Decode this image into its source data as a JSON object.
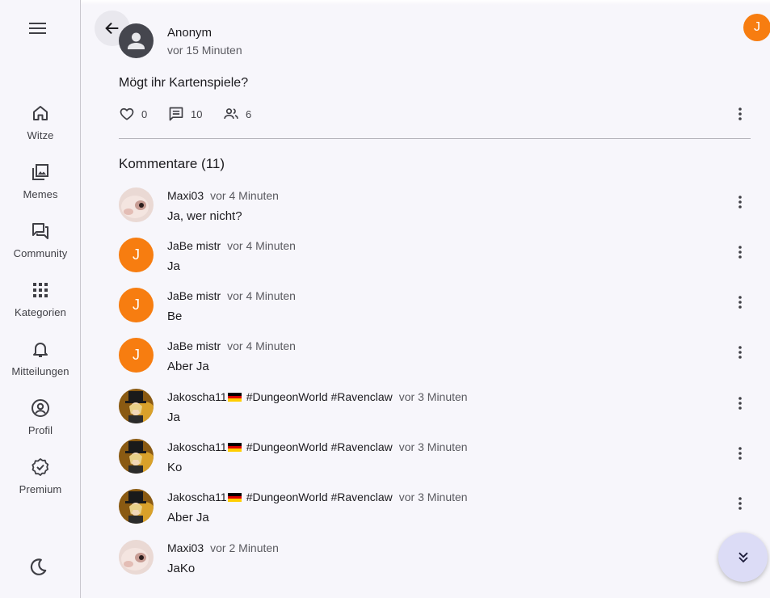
{
  "rail": {
    "menu_icon": "menu-icon",
    "items": [
      {
        "label": "Witze",
        "icon": "home-icon"
      },
      {
        "label": "Memes",
        "icon": "image-gallery-icon"
      },
      {
        "label": "Community",
        "icon": "forum-icon"
      },
      {
        "label": "Kategorien",
        "icon": "grid-icon"
      },
      {
        "label": "Mitteilungen",
        "icon": "bell-icon"
      },
      {
        "label": "Profil",
        "icon": "account-circle-icon"
      },
      {
        "label": "Premium",
        "icon": "verified-badge-icon"
      }
    ],
    "theme_icon": "moon-icon"
  },
  "header": {
    "back_icon": "arrow-back-icon",
    "user_avatar_initial": "J"
  },
  "post": {
    "author": "Anonym",
    "time": "vor 15 Minuten",
    "text": "Mögt ihr Kartenspiele?",
    "likes": "0",
    "comments": "10",
    "participants": "6"
  },
  "comments_heading": "Kommentare (11)",
  "comments": [
    {
      "author": "Maxi03",
      "time": "vor 4 Minuten",
      "text": "Ja, wer nicht?",
      "avatar": "photo-hamster"
    },
    {
      "author": "JaBe mistr",
      "time": "vor 4 Minuten",
      "text": "Ja",
      "avatar": "J"
    },
    {
      "author": "JaBe mistr",
      "time": "vor 4 Minuten",
      "text": "Be",
      "avatar": "J"
    },
    {
      "author": "JaBe mistr",
      "time": "vor 4 Minuten",
      "text": "Aber Ja",
      "avatar": "J"
    },
    {
      "author": "Jakoscha11",
      "author_suffix": "#DungeonWorld #Ravenclaw",
      "time": "vor 3 Minuten",
      "text": "Ja",
      "avatar": "photo-tophat"
    },
    {
      "author": "Jakoscha11",
      "author_suffix": "#DungeonWorld #Ravenclaw",
      "time": "vor 3 Minuten",
      "text": "Ko",
      "avatar": "photo-tophat"
    },
    {
      "author": "Jakoscha11",
      "author_suffix": "#DungeonWorld #Ravenclaw",
      "time": "vor 3 Minuten",
      "text": "Aber Ja",
      "avatar": "photo-tophat"
    },
    {
      "author": "Maxi03",
      "time": "vor 2 Minuten",
      "text": "JaKo",
      "avatar": "photo-hamster"
    }
  ],
  "colors": {
    "accent_orange": "#f77d10",
    "fab_bg": "#dcdcf6",
    "background": "#f7f6fb"
  }
}
